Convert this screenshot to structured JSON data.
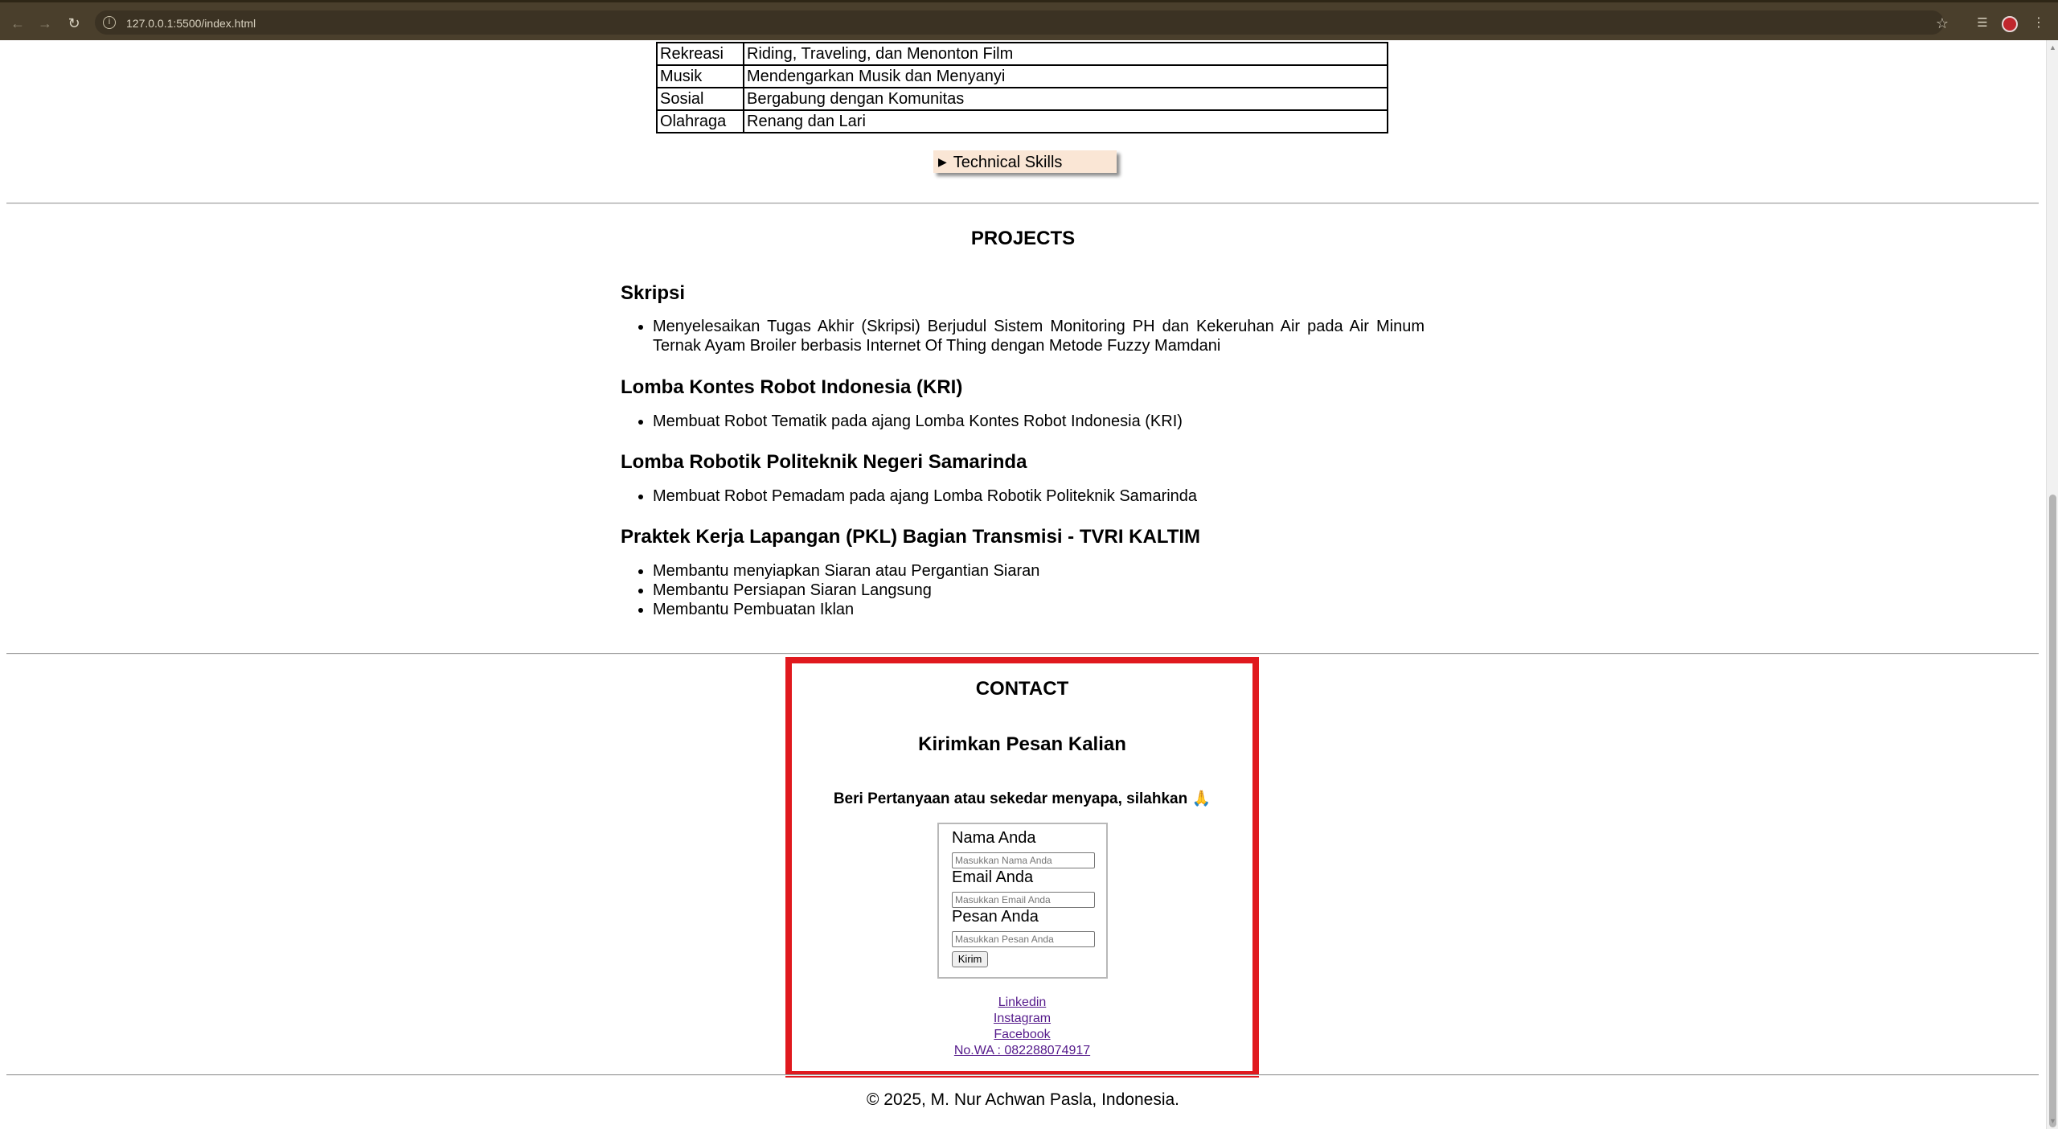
{
  "browser": {
    "url": "127.0.0.1:5500/index.html"
  },
  "hobbies": [
    {
      "category": "Rekreasi",
      "detail": "Riding, Traveling, dan Menonton Film"
    },
    {
      "category": "Musik",
      "detail": "Mendengarkan Musik dan Menyanyi"
    },
    {
      "category": "Sosial",
      "detail": "Bergabung dengan Komunitas"
    },
    {
      "category": "Olahraga",
      "detail": "Renang dan Lari"
    }
  ],
  "technical_skills_label": "Technical Skills",
  "projects": {
    "title": "PROJECTS",
    "items": [
      {
        "heading": "Skripsi",
        "bullets": [
          "Menyelesaikan Tugas Akhir (Skripsi) Berjudul Sistem Monitoring PH dan Kekeruhan Air pada Air Minum Ternak Ayam Broiler berbasis Internet Of Thing dengan Metode Fuzzy Mamdani"
        ]
      },
      {
        "heading": "Lomba Kontes Robot Indonesia (KRI)",
        "bullets": [
          "Membuat Robot Tematik pada ajang Lomba Kontes Robot Indonesia (KRI)"
        ]
      },
      {
        "heading": "Lomba Robotik Politeknik Negeri Samarinda",
        "bullets": [
          "Membuat Robot Pemadam pada ajang Lomba Robotik Politeknik Samarinda"
        ]
      },
      {
        "heading": "Praktek Kerja Lapangan (PKL) Bagian Transmisi - TVRI KALTIM",
        "bullets": [
          "Membantu menyiapkan Siaran atau Pergantian Siaran",
          "Membantu Persiapan Siaran Langsung",
          "Membantu Pembuatan Iklan"
        ]
      }
    ]
  },
  "contact": {
    "title": "CONTACT",
    "subtitle": "Kirimkan Pesan Kalian",
    "prompt": "Beri Pertanyaan atau sekedar menyapa, silahkan 🙏",
    "form": {
      "name_label": "Nama Anda",
      "name_placeholder": "Masukkan Nama Anda",
      "email_label": "Email Anda",
      "email_placeholder": "Masukkan Email Anda",
      "message_label": "Pesan Anda",
      "message_placeholder": "Masukkan Pesan Anda",
      "submit_label": "Kirim"
    },
    "links": [
      "Linkedin",
      "Instagram",
      "Facebook",
      "No.WA : 082288074917"
    ]
  },
  "footer": "© 2025, M. Nur Achwan Pasla, Indonesia."
}
